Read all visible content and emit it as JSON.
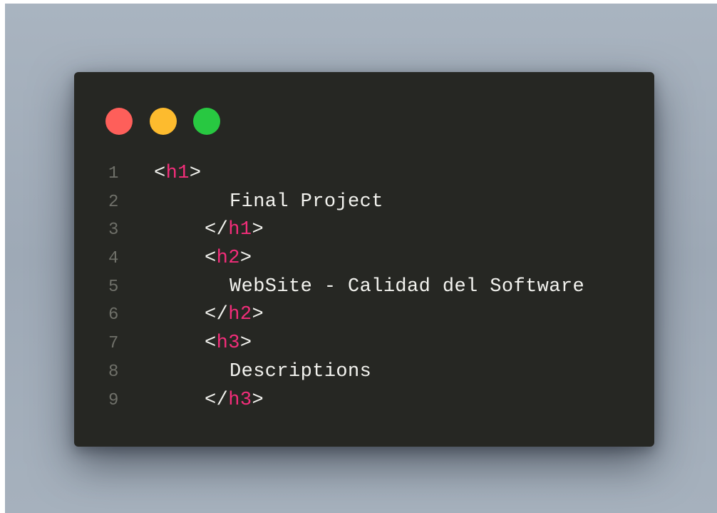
{
  "window_controls": {
    "close_color": "#fe5f5a",
    "minimize_color": "#fdbb2e",
    "maximize_color": "#28c841"
  },
  "code_lines": [
    {
      "number": "1",
      "kind": "tag",
      "open": "<",
      "name": "h1",
      "close": ">"
    },
    {
      "number": "2",
      "kind": "text",
      "text": "Final Project"
    },
    {
      "number": "3",
      "kind": "tag",
      "open": "</",
      "name": "h1",
      "close": ">"
    },
    {
      "number": "4",
      "kind": "tag",
      "open": "<",
      "name": "h2",
      "close": ">"
    },
    {
      "number": "5",
      "kind": "text",
      "text": "WebSite - Calidad del Software"
    },
    {
      "number": "6",
      "kind": "tag",
      "open": "</",
      "name": "h2",
      "close": ">"
    },
    {
      "number": "7",
      "kind": "tag",
      "open": "<",
      "name": "h3",
      "close": ">"
    },
    {
      "number": "8",
      "kind": "text",
      "text": "Descriptions"
    },
    {
      "number": "9",
      "kind": "tag",
      "open": "</",
      "name": "h3",
      "close": ">"
    }
  ],
  "colors": {
    "window_bg": "#262723",
    "tag_name": "#f32d7a",
    "text": "#f3f3ef",
    "line_number": "#6f7069"
  }
}
